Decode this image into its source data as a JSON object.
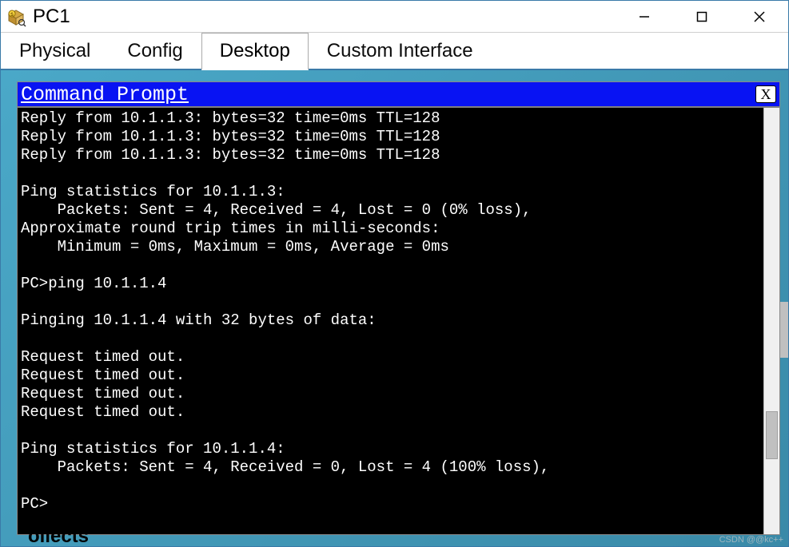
{
  "window": {
    "title": "PC1"
  },
  "tabs": [
    {
      "label": "Physical",
      "active": false
    },
    {
      "label": "Config",
      "active": false
    },
    {
      "label": "Desktop",
      "active": true
    },
    {
      "label": "Custom Interface",
      "active": false
    }
  ],
  "inner_window": {
    "title": "Command Prompt",
    "close_label": "X"
  },
  "terminal_lines": [
    "Reply from 10.1.1.3: bytes=32 time=0ms TTL=128",
    "Reply from 10.1.1.3: bytes=32 time=0ms TTL=128",
    "Reply from 10.1.1.3: bytes=32 time=0ms TTL=128",
    "",
    "Ping statistics for 10.1.1.3:",
    "    Packets: Sent = 4, Received = 4, Lost = 0 (0% loss),",
    "Approximate round trip times in milli-seconds:",
    "    Minimum = 0ms, Maximum = 0ms, Average = 0ms",
    "",
    "PC>ping 10.1.1.4",
    "",
    "Pinging 10.1.1.4 with 32 bytes of data:",
    "",
    "Request timed out.",
    "Request timed out.",
    "Request timed out.",
    "Request timed out.",
    "",
    "Ping statistics for 10.1.1.4:",
    "    Packets: Sent = 4, Received = 0, Lost = 4 (100% loss),",
    "",
    "PC>"
  ],
  "bottom_text": "ollects",
  "watermark": "CSDN @@kc++"
}
